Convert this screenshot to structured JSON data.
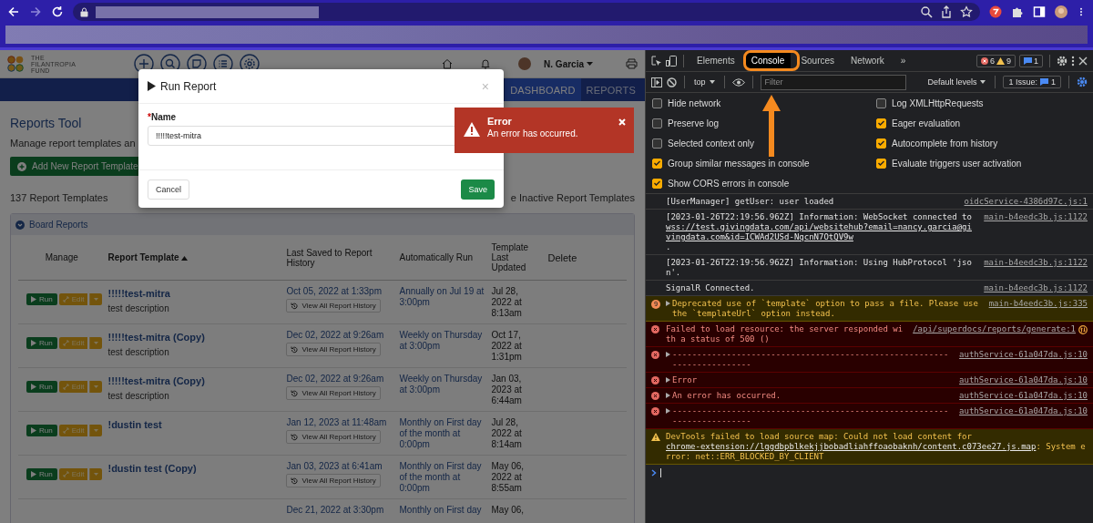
{
  "app": {
    "logo_lines": [
      "THE",
      "FILANTROPIA",
      "FUND"
    ],
    "user": "N. Garcia",
    "nav_tabs": [
      {
        "label": "DASHBOARD",
        "selected": true
      },
      {
        "label": "REPORTS",
        "selected": false
      }
    ],
    "page_title": "Reports Tool",
    "subtitle": "Manage report templates an",
    "add_button": "Add New Report Template",
    "count": "137 Report Templates",
    "inactive_link": "e Inactive Report Templates",
    "section": {
      "title": "Board Reports",
      "expanded": true
    },
    "columns": [
      "Manage",
      "Report Template",
      "Last Saved to Report History",
      "Automatically Run",
      "Template Last Updated",
      "Delete"
    ],
    "rows": [
      {
        "run": "Run",
        "edit": "Edit",
        "name": "!!!!!test-mitra",
        "description": "test description",
        "last_saved": "Oct 05, 2022 at 1:33pm",
        "history": "View All Report History",
        "auto_run": "Annually on Jul 19 at 3:00pm",
        "updated": "Jul 28, 2022 at 8:13am"
      },
      {
        "run": "Run",
        "edit": "Edit",
        "name": "!!!!!test-mitra (Copy)",
        "description": "test description",
        "last_saved": "Dec 02, 2022 at 9:26am",
        "history": "View All Report History",
        "auto_run": "Weekly on Thursday at 3:00pm",
        "updated": "Oct 17, 2022 at 1:31pm"
      },
      {
        "run": "Run",
        "edit": "Edit",
        "name": "!!!!!test-mitra (Copy)",
        "description": "test description",
        "last_saved": "Dec 02, 2022 at 9:26am",
        "history": "View All Report History",
        "auto_run": "Weekly on Thursday at 3:00pm",
        "updated": "Jan 03, 2023 at 6:44am"
      },
      {
        "run": "Run",
        "edit": "Edit",
        "name": "!dustin test",
        "last_saved": "Jan 12, 2023 at 11:48am",
        "history": "View All Report History",
        "auto_run": "Monthly on First day of the month at 0:00pm",
        "updated": "Jul 28, 2022 at 8:14am"
      },
      {
        "run": "Run",
        "edit": "Edit",
        "name": "!dustin test (Copy)",
        "last_saved": "Jan 03, 2023 at 6:41am",
        "history": "View All Report History",
        "auto_run": "Monthly on First day of the month at 0:00pm",
        "updated": "May 06, 2022 at 8:55am"
      },
      {
        "last_saved": "Dec 21, 2022 at 3:30pm",
        "auto_run": "Monthly on First day",
        "updated": "May 06,"
      }
    ]
  },
  "modal": {
    "title": "Run Report",
    "close": "×",
    "required_mark": "*",
    "field_label": "Name",
    "value": "!!!!!test-mitra",
    "cancel": "Cancel",
    "save": "Save"
  },
  "toast": {
    "title": "Error",
    "message": "An error has occurred."
  },
  "devtools": {
    "tabs": [
      {
        "label": "Elements",
        "selected": false
      },
      {
        "label": "Console",
        "selected": true
      },
      {
        "label": "Sources",
        "selected": false
      },
      {
        "label": "Network",
        "selected": false
      }
    ],
    "more": "»",
    "error_count": "6",
    "warning_count": "9",
    "message_count": "1",
    "context": "top",
    "filter_placeholder": "Filter",
    "levels": "Default levels",
    "issues_label": "1 Issue:",
    "issues_count": "1",
    "settings_left": [
      {
        "label": "Hide network",
        "checked": false
      },
      {
        "label": "Preserve log",
        "checked": false
      },
      {
        "label": "Selected context only",
        "checked": false
      },
      {
        "label": "Group similar messages in console",
        "checked": true
      },
      {
        "label": "Show CORS errors in console",
        "checked": true
      }
    ],
    "settings_right": [
      {
        "label": "Log XMLHttpRequests",
        "checked": false
      },
      {
        "label": "Eager evaluation",
        "checked": true
      },
      {
        "label": "Autocomplete from history",
        "checked": true
      },
      {
        "label": "Evaluate triggers user activation",
        "checked": true
      }
    ],
    "messages": [
      {
        "kind": "info",
        "text": "[UserManager] getUser: user loaded",
        "source": "oidcService-4386d97c.js:1"
      },
      {
        "kind": "info",
        "text": "[2023-01-26T22:19:56.962Z] Information: WebSocket connected to ",
        "link": "wss://test.givingdata.com/api/websitehub?email=nancy.garcia@givingdata.com&id=ICWAd2USd-NqcnN7OtQV9w",
        "after": ".",
        "source": "main-b4eedc3b.js:1122"
      },
      {
        "kind": "info",
        "text": "[2023-01-26T22:19:56.962Z] Information: Using HubProtocol 'json'.",
        "source": "main-b4eedc3b.js:1122"
      },
      {
        "kind": "info",
        "text": "SignalR Connected.",
        "source": "main-b4eedc3b.js:1122"
      },
      {
        "kind": "warning",
        "count": "9",
        "expandable": true,
        "text": "Deprecated use of `template` option to pass a file. Please use the `templateUrl` option instead.",
        "source": "main-b4eedc3b.js:335"
      },
      {
        "kind": "error",
        "text": "Failed to load resource: the server responded with a status of 500 ()",
        "source": "/api/superdocs/reports/generate:1",
        "network": true
      },
      {
        "kind": "error",
        "expandable": true,
        "text": "------------------------------------------------------------------------",
        "source": "authService-61a047da.js:10"
      },
      {
        "kind": "error",
        "expandable": true,
        "text": "Error",
        "source": "authService-61a047da.js:10"
      },
      {
        "kind": "error",
        "expandable": true,
        "text": "An error has occurred.",
        "source": "authService-61a047da.js:10"
      },
      {
        "kind": "error",
        "expandable": true,
        "text": "------------------------------------------------------------------------",
        "source": "authService-61a047da.js:10"
      },
      {
        "kind": "warning",
        "text": "DevTools failed to load source map: Could not load content for ",
        "link": "chrome-extension://lggdbpblkekjjbobadliahffoaobaknh/content.c073ee27.js.map",
        "after": ": System error: net::ERR_BLOCKED_BY_CLIENT"
      }
    ]
  }
}
